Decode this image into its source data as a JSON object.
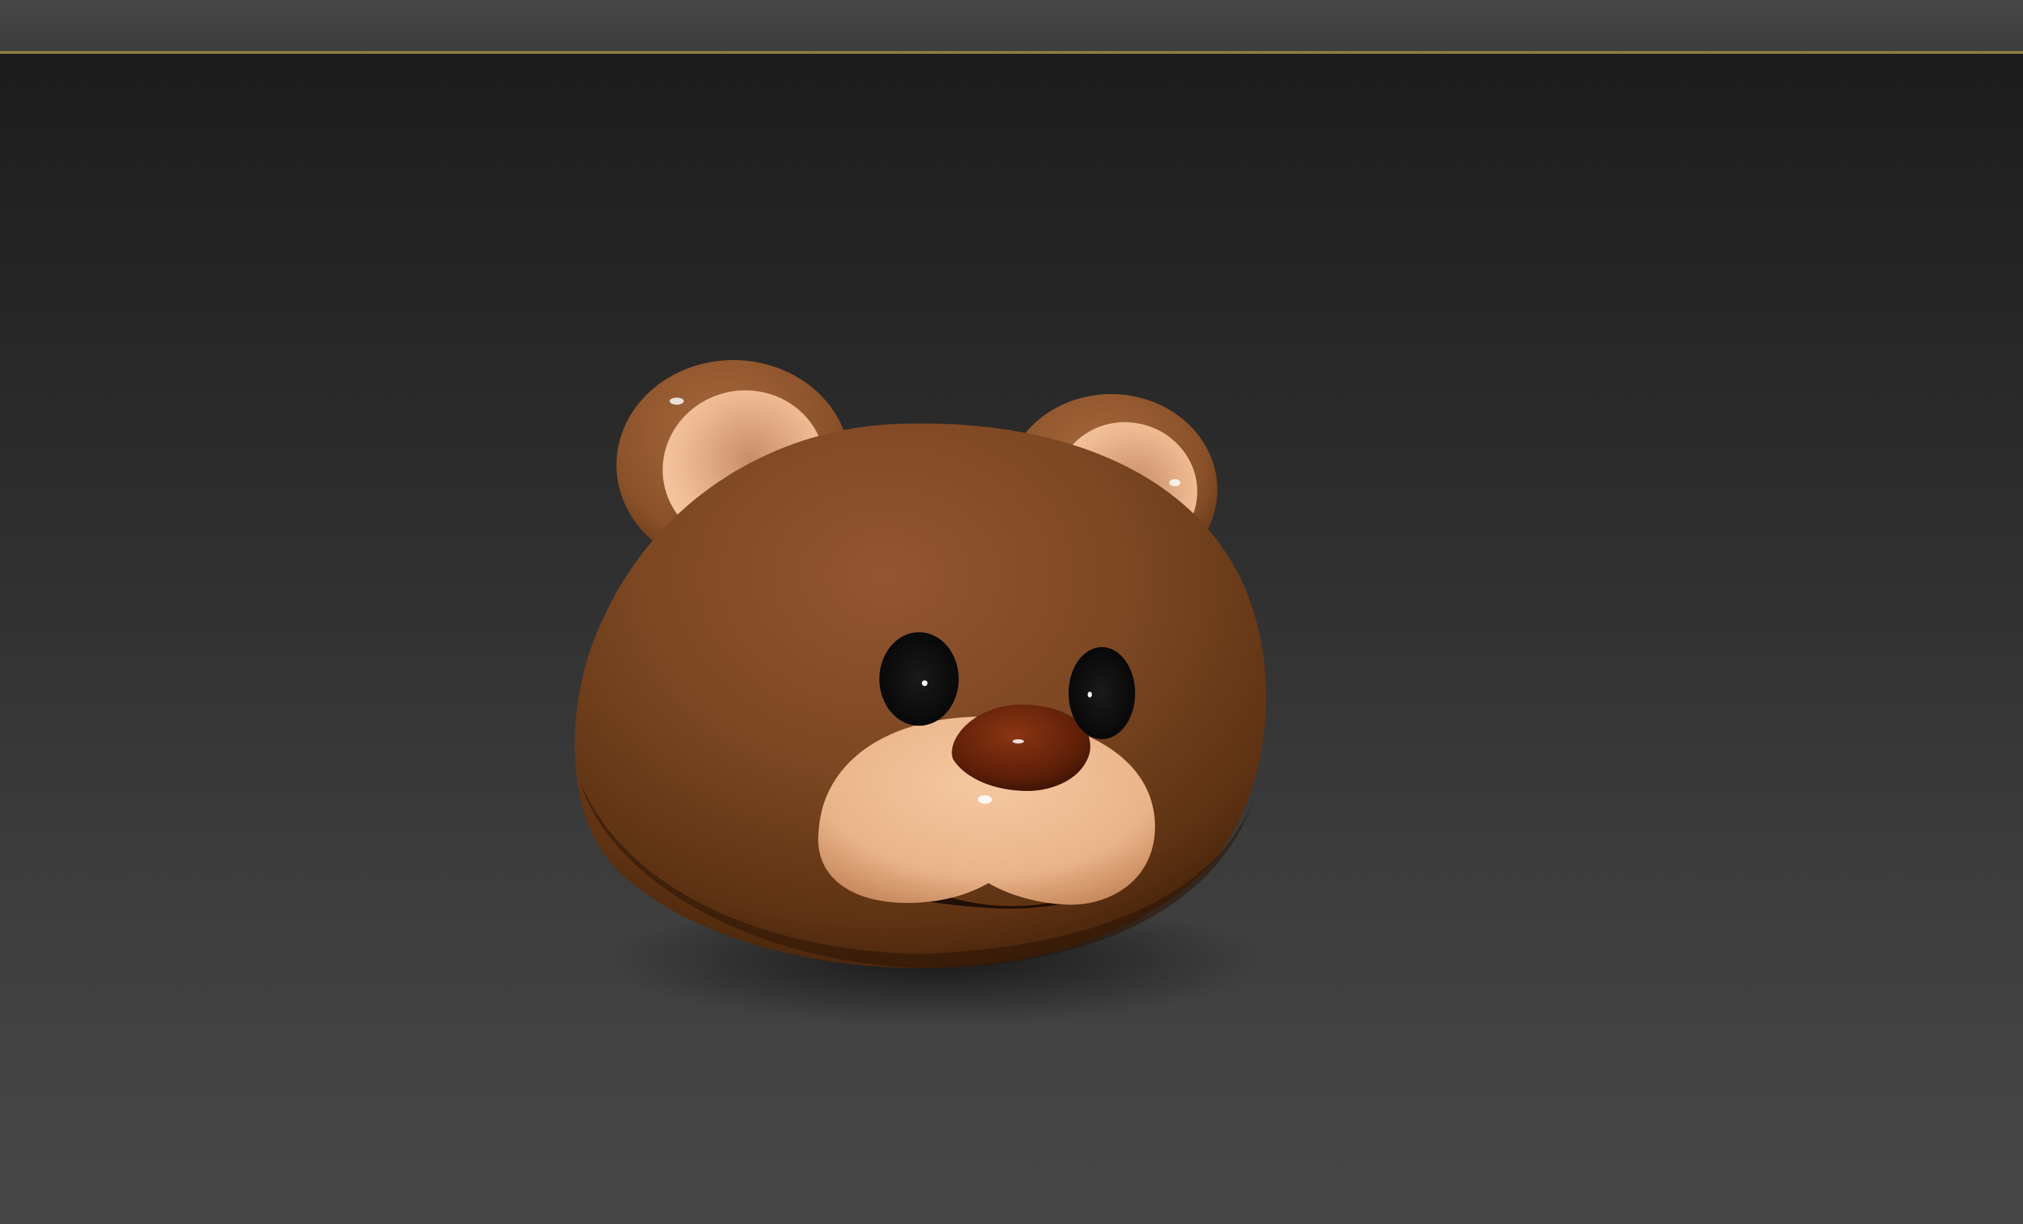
{
  "app": {
    "top_bar": {},
    "viewport": {
      "active_border_color": "#8a7d3f",
      "background_top": "#1c1c1c",
      "background_bottom": "#474747",
      "model": {
        "object": "bear-head",
        "fur_color": "#7a4522",
        "muzzle_color": "#f0b88f",
        "nose_color": "#5a1e0a",
        "eye_color": "#0c0c0c"
      }
    }
  }
}
